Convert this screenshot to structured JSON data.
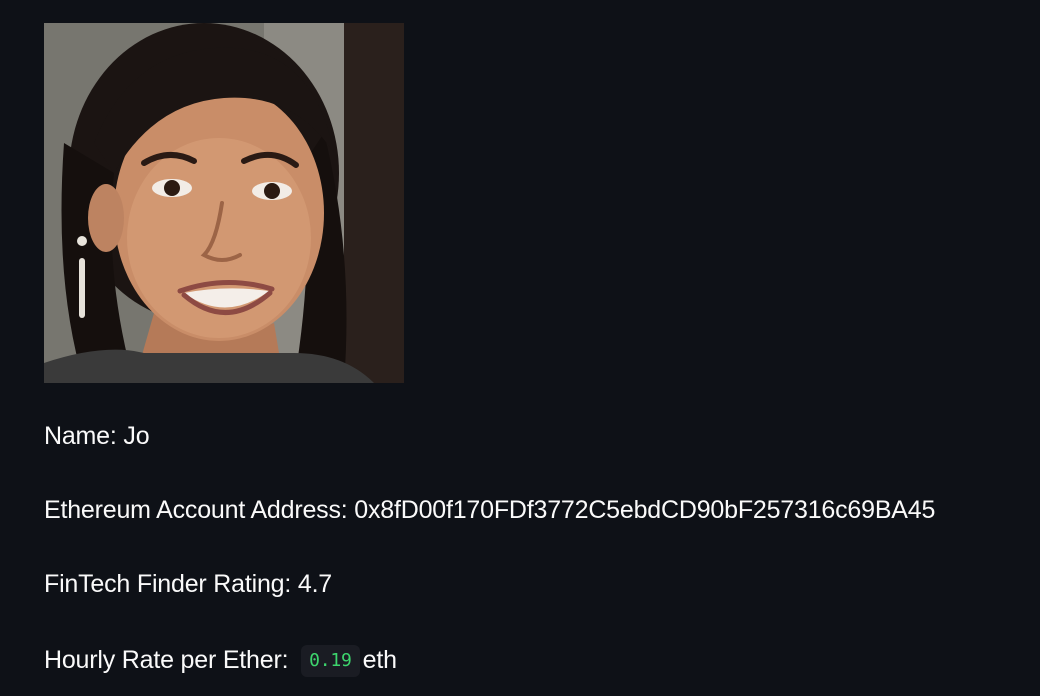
{
  "profile": {
    "photo_alt": "Profile photo",
    "name_label": "Name: ",
    "name_value": "Jo",
    "address_label": "Ethereum Account Address: ",
    "address_value": "0x8fD00f170FDf3772C5ebdCD90bF257316c69BA45",
    "rating_label": "FinTech Finder Rating: ",
    "rating_value": "4.7",
    "rate_label": "Hourly Rate per Ether: ",
    "rate_value": "0.19",
    "rate_unit": "eth"
  },
  "colors": {
    "background": "#0e1117",
    "text": "#fafafa",
    "code_text": "#3dd56d",
    "code_background": "#1a1c23"
  }
}
